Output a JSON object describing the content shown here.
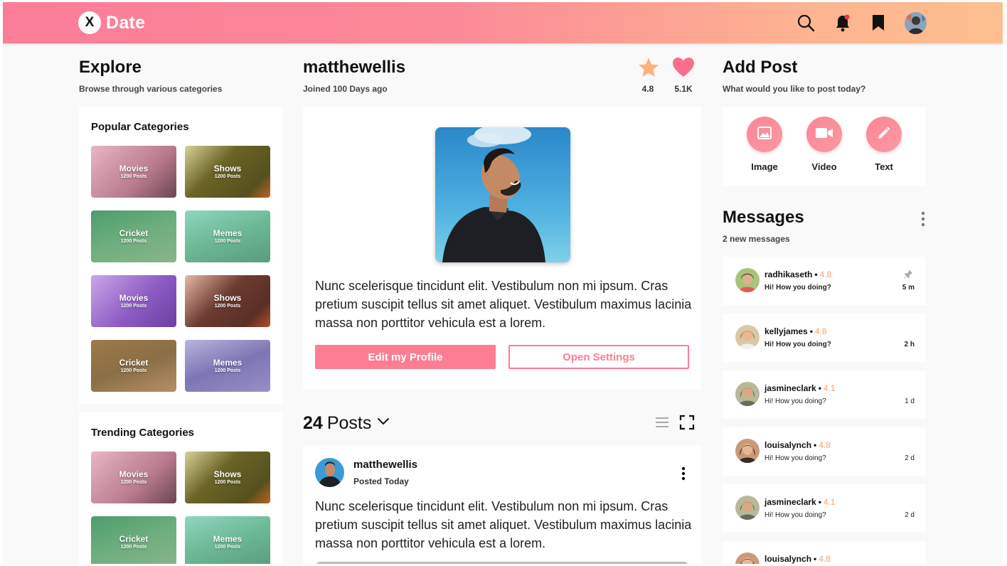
{
  "app": {
    "logo_letter": "X",
    "logo_text": "Date"
  },
  "header": {
    "icons": [
      "search-icon",
      "bell-icon",
      "bookmark-icon",
      "avatar"
    ],
    "notification_dot_color": "#e8345a"
  },
  "explore": {
    "title": "Explore",
    "subtitle": "Browse through various categories",
    "popular": {
      "title": "Popular Categories",
      "items": [
        {
          "name": "Movies",
          "count": "1200 Posts"
        },
        {
          "name": "Shows",
          "count": "1200 Posts"
        },
        {
          "name": "Cricket",
          "count": "1200 Posts"
        },
        {
          "name": "Memes",
          "count": "1200 Posts"
        },
        {
          "name": "Movies",
          "count": "1200 Posts"
        },
        {
          "name": "Shows",
          "count": "1200 Posts"
        },
        {
          "name": "Cricket",
          "count": "1200 Posts"
        },
        {
          "name": "Memes",
          "count": "1200 Posts"
        }
      ]
    },
    "trending": {
      "title": "Trending Categories",
      "items": [
        {
          "name": "Movies",
          "count": "1200 Posts"
        },
        {
          "name": "Shows",
          "count": "1200 Posts"
        },
        {
          "name": "Cricket",
          "count": "1200 Posts"
        },
        {
          "name": "Memes",
          "count": "1200 Posts"
        }
      ]
    }
  },
  "profile": {
    "username": "matthewellis",
    "joined": "Joined 100 Days ago",
    "rating": "4.8",
    "likes": "5.1K",
    "bio": "Nunc scelerisque tincidunt elit. Vestibulum non mi ipsum. Cras pretium suscipit tellus sit amet aliquet. Vestibulum maximus lacinia massa non porttitor vehicula est a lorem.",
    "edit_button": "Edit my Profile",
    "settings_button": "Open Settings"
  },
  "posts": {
    "count": "24",
    "label": "Posts",
    "items": [
      {
        "author": "matthewellis",
        "time": "Posted Today",
        "text": "Nunc scelerisque tincidunt elit. Vestibulum non mi ipsum. Cras pretium suscipit tellus sit amet aliquet. Vestibulum maximus lacinia massa non porttitor vehicula est a lorem."
      }
    ]
  },
  "add_post": {
    "title": "Add Post",
    "subtitle": "What would you like to post today?",
    "options": [
      {
        "label": "Image",
        "icon": "image-icon"
      },
      {
        "label": "Video",
        "icon": "video-icon"
      },
      {
        "label": "Text",
        "icon": "pencil-icon"
      }
    ]
  },
  "messages": {
    "title": "Messages",
    "subtitle": "2 new messages",
    "items": [
      {
        "name": "radhikaseth",
        "rating": "4.8",
        "text": "Hi! How you doing?",
        "time": "5 m",
        "unread": true,
        "pinned": true
      },
      {
        "name": "kellyjames",
        "rating": "4.8",
        "text": "Hi! How you doing?",
        "time": "2 h",
        "unread": true,
        "pinned": false
      },
      {
        "name": "jasmineclark",
        "rating": "4.1",
        "text": "Hi! How you doing?",
        "time": "1 d",
        "unread": false,
        "pinned": false
      },
      {
        "name": "louisalynch",
        "rating": "4.8",
        "text": "Hi! How you doing?",
        "time": "2 d",
        "unread": false,
        "pinned": false
      },
      {
        "name": "jasmineclark",
        "rating": "4.1",
        "text": "Hi! How you doing?",
        "time": "2 d",
        "unread": false,
        "pinned": false
      },
      {
        "name": "louisalynch",
        "rating": "4.8",
        "text": "",
        "time": "",
        "unread": false,
        "pinned": false
      }
    ]
  },
  "colors": {
    "accent": "#fb7e93",
    "rating": "#f9a36a",
    "heart": "#fb6f8e",
    "star": "#fbb27c"
  }
}
